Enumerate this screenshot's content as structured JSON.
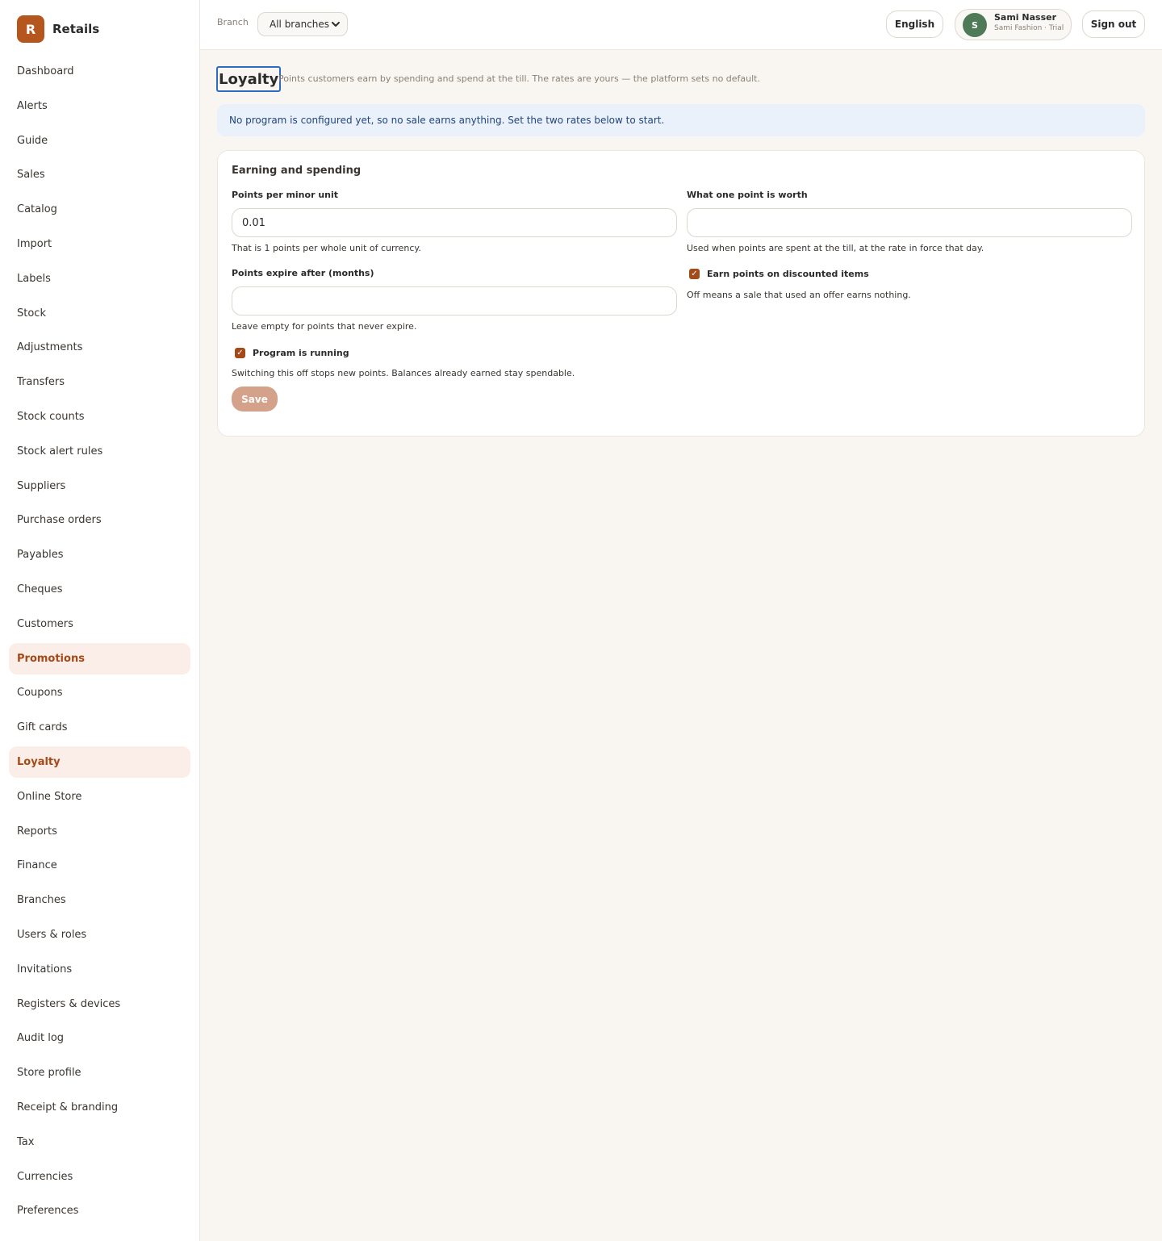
{
  "brand": {
    "logo_letter": "R",
    "name": "Retails"
  },
  "sidebar": {
    "items": [
      {
        "label": "Dashboard"
      },
      {
        "label": "Alerts"
      },
      {
        "label": "Guide"
      },
      {
        "label": "Sales"
      },
      {
        "label": "Catalog"
      },
      {
        "label": "Import"
      },
      {
        "label": "Labels"
      },
      {
        "label": "Stock"
      },
      {
        "label": "Adjustments"
      },
      {
        "label": "Transfers"
      },
      {
        "label": "Stock counts"
      },
      {
        "label": "Stock alert rules"
      },
      {
        "label": "Suppliers"
      },
      {
        "label": "Purchase orders"
      },
      {
        "label": "Payables"
      },
      {
        "label": "Cheques"
      },
      {
        "label": "Customers"
      },
      {
        "label": "Promotions"
      },
      {
        "label": "Coupons"
      },
      {
        "label": "Gift cards"
      },
      {
        "label": "Loyalty"
      },
      {
        "label": "Online Store"
      },
      {
        "label": "Reports"
      },
      {
        "label": "Finance"
      },
      {
        "label": "Branches"
      },
      {
        "label": "Users & roles"
      },
      {
        "label": "Invitations"
      },
      {
        "label": "Registers & devices"
      },
      {
        "label": "Audit log"
      },
      {
        "label": "Store profile"
      },
      {
        "label": "Receipt & branding"
      },
      {
        "label": "Tax"
      },
      {
        "label": "Currencies"
      },
      {
        "label": "Preferences"
      }
    ],
    "highlighted": [
      "Promotions",
      "Loyalty"
    ]
  },
  "topbar": {
    "branch_label": "Branch",
    "branch_value": "All branches",
    "language": "English",
    "user": {
      "initial": "S",
      "name": "Sami Nasser",
      "subtitle": "Sami Fashion · Trial"
    },
    "sign_out": "Sign out"
  },
  "page": {
    "title": "Loyalty",
    "subtitle": "Points customers earn by spending and spend at the till. The rates are yours — the platform sets no default.",
    "notice": "No program is configured yet, so no sale earns anything. Set the two rates below to start."
  },
  "form": {
    "section_title": "Earning and spending",
    "points_per_minor_unit": {
      "label": "Points per minor unit",
      "value": "0.01",
      "hint": "That is 1 points per whole unit of currency."
    },
    "point_worth": {
      "label": "What one point is worth",
      "value": "",
      "hint": "Used when points are spent at the till, at the rate in force that day."
    },
    "expire_months": {
      "label": "Points expire after (months)",
      "value": "",
      "hint": "Leave empty for points that never expire."
    },
    "earn_on_discounted": {
      "label": "Earn points on discounted items",
      "checked": true,
      "hint": "Off means a sale that used an offer earns nothing."
    },
    "program_running": {
      "label": "Program is running",
      "checked": true,
      "hint": "Switching this off stops new points. Balances already earned stay spendable."
    },
    "save_label": "Save"
  },
  "colors": {
    "accent": "#a34a18",
    "brand": "#b5561f",
    "notice_bg": "#eaf1fb",
    "save_disabled": "#d4a28b"
  }
}
